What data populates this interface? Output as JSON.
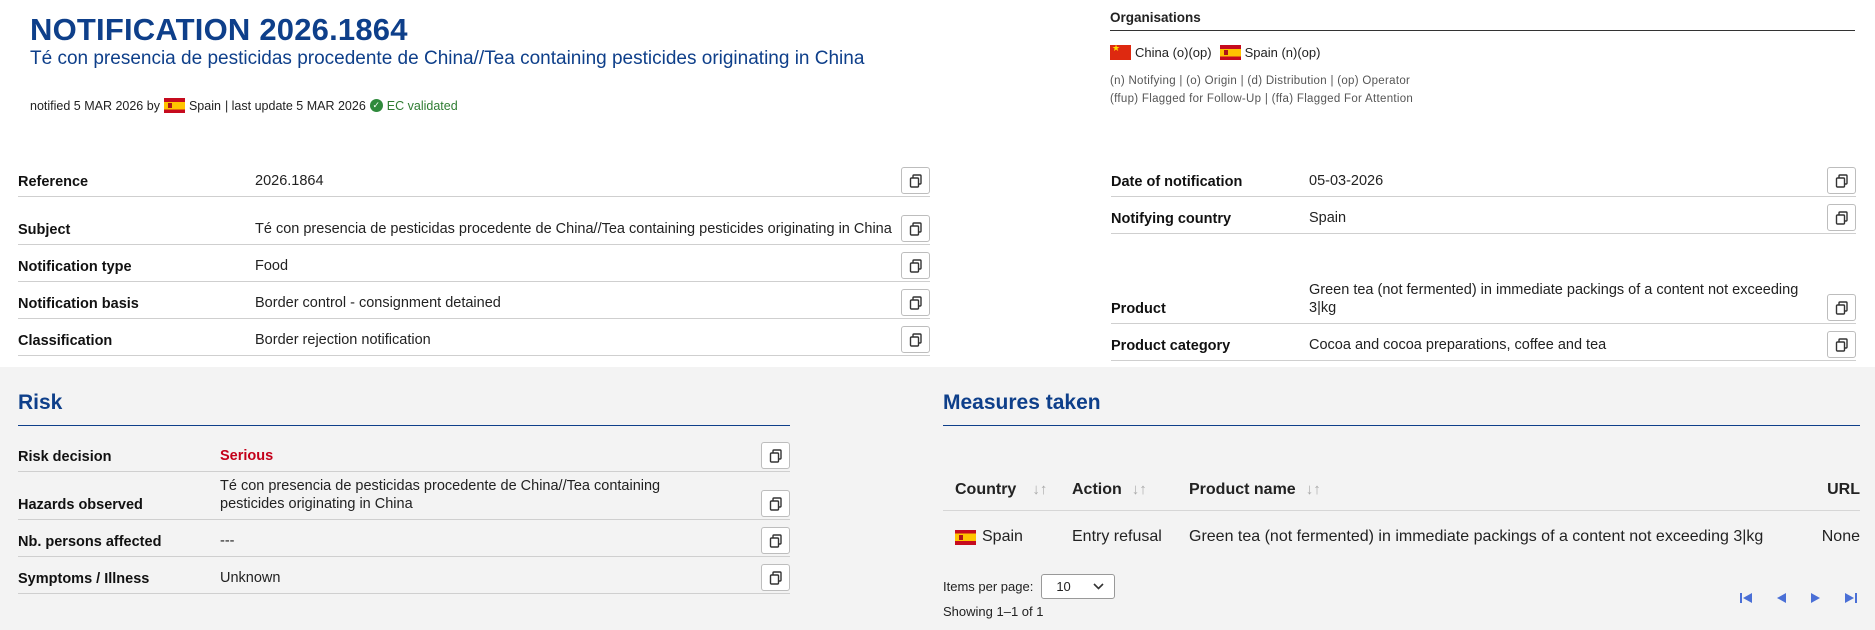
{
  "header": {
    "title": "NOTIFICATION 2026.1864",
    "subtitle": "Té con presencia de pesticidas procedente de China//Tea containing pesticides originating in China",
    "notified_prefix": "notified 5 MAR 2026 by",
    "notified_country": "Spain",
    "last_update": "| last update 5 MAR 2026",
    "validated": "EC validated"
  },
  "organisations": {
    "heading": "Organisations",
    "items": [
      {
        "flag": "china-flag",
        "text": "China (o)(op)"
      },
      {
        "flag": "spain-flag",
        "text": "Spain (n)(op)"
      }
    ],
    "legend_line1": "(n) Notifying | (o) Origin | (d) Distribution | (op) Operator",
    "legend_line2": "(ffup) Flagged for Follow-Up | (ffa) Flagged For Attention"
  },
  "details_left": [
    {
      "label": "Reference",
      "value": "2026.1864"
    },
    {
      "label": "Subject",
      "value": "Té con presencia de pesticidas procedente de China//Tea containing pesticides originating in China"
    },
    {
      "label": "Notification type",
      "value": "Food"
    },
    {
      "label": "Notification basis",
      "value": "Border control - consignment detained"
    },
    {
      "label": "Classification",
      "value": "Border rejection notification"
    }
  ],
  "details_right": [
    {
      "label": "Date of notification",
      "value": "05-03-2026"
    },
    {
      "label": "Notifying country",
      "value": "Spain"
    },
    {
      "label": "Product",
      "value": "Green tea (not fermented) in immediate packings of a content not exceeding 3|kg"
    },
    {
      "label": "Product category",
      "value": "Cocoa and cocoa preparations, coffee and tea"
    }
  ],
  "risk": {
    "title": "Risk",
    "rows": [
      {
        "label": "Risk decision",
        "value": "Serious"
      },
      {
        "label": "Hazards observed",
        "value": "Té con presencia de pesticidas procedente de China//Tea containing pesticides originating in China"
      },
      {
        "label": "Nb. persons affected",
        "value": "---"
      },
      {
        "label": "Symptoms / Illness",
        "value": "Unknown"
      }
    ]
  },
  "measures": {
    "title": "Measures taken",
    "columns": [
      "Country",
      "Action",
      "Product name",
      "URL"
    ],
    "rows": [
      {
        "country": "Spain",
        "action": "Entry refusal",
        "product": "Green tea (not fermented) in immediate packings of a content not exceeding 3|kg",
        "url": "None"
      }
    ],
    "items_per_page_label": "Items per page:",
    "items_per_page": "10",
    "showing": "Showing 1–1 of 1"
  },
  "colors": {
    "accent": "#0e3f8a",
    "danger": "#c4001a",
    "valid": "#2f7d32"
  },
  "icons": {
    "copy": "copy-icon",
    "sort": "sort-icon",
    "check": "check-circle-icon"
  }
}
